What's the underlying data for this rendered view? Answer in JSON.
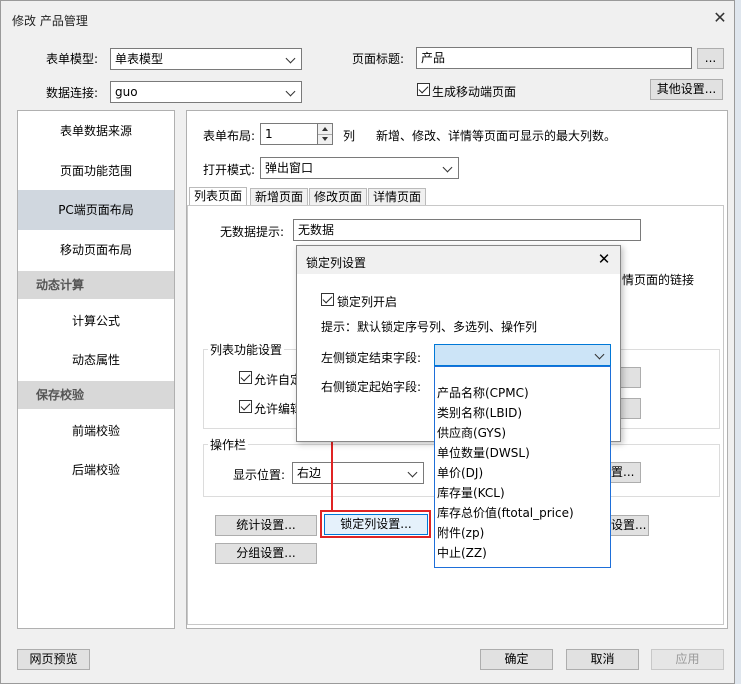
{
  "window": {
    "title": "修改 产品管理",
    "close_glyph": "✕"
  },
  "header": {
    "form_model_label": "表单模型:",
    "form_model_value": "单表模型",
    "page_title_label": "页面标题:",
    "page_title_value": "产品",
    "ellipsis": "...",
    "data_conn_label": "数据连接:",
    "data_conn_value": "guo",
    "gen_mobile_label": "生成移动端页面",
    "gen_mobile_checked": true,
    "other_settings": "其他设置..."
  },
  "sidebar": {
    "items": [
      {
        "label": "表单数据来源",
        "type": "item"
      },
      {
        "label": "页面功能范围",
        "type": "item"
      },
      {
        "label": "PC端页面布局",
        "type": "item",
        "active": true
      },
      {
        "label": "移动页面布局",
        "type": "item"
      },
      {
        "label": "动态计算",
        "type": "header"
      },
      {
        "label": "计算公式",
        "type": "item"
      },
      {
        "label": "动态属性",
        "type": "item"
      },
      {
        "label": "保存校验",
        "type": "header"
      },
      {
        "label": "前端校验",
        "type": "item"
      },
      {
        "label": "后端校验",
        "type": "item"
      }
    ]
  },
  "main": {
    "layout_label": "表单布局:",
    "layout_value": "1",
    "col_unit": "列",
    "layout_hint": "新增、修改、详情等页面可显示的最大列数。",
    "open_mode_label": "打开模式:",
    "open_mode_value": "弹出窗口",
    "tabs": [
      "列表页面",
      "新增页面",
      "修改页面",
      "详情页面"
    ],
    "no_data_label": "无数据提示:",
    "no_data_value": "无数据",
    "link_text_partial": "情页面的链接",
    "list_func_group": "列表功能设置",
    "allow_custom_partial": "允许自定",
    "allow_edit_partial": "允许编辑",
    "operate_group": "操作栏",
    "display_pos_label": "显示位置:",
    "display_pos_value": "右边",
    "settings_partial": "置...",
    "btn_stats": "统计设置...",
    "btn_lock_cols": "锁定列设置...",
    "btn_group": "分组设置...",
    "btn_settings_partial": "设置..."
  },
  "lock_dialog": {
    "title": "锁定列设置",
    "enable_label": "锁定列开启",
    "enable_checked": true,
    "hint": "提示：默认锁定序号列、多选列、操作列",
    "left_end_label": "左侧锁定结束字段:",
    "left_end_value": "",
    "right_start_label": "右侧锁定起始字段:"
  },
  "dropdown_options": [
    "产品名称(CPMC)",
    "类别名称(LBID)",
    "供应商(GYS)",
    "单位数量(DWSL)",
    "单价(DJ)",
    "库存量(KCL)",
    "库存总价值(ftotal_price)",
    "附件(zp)",
    "中止(ZZ)"
  ],
  "footer": {
    "preview": "网页预览",
    "ok": "确定",
    "cancel": "取消",
    "apply": "应用"
  },
  "colors": {
    "highlight_red": "#e02424",
    "sidebar_active": "#d0d7df",
    "dropdown_border": "#1e6fd9"
  }
}
